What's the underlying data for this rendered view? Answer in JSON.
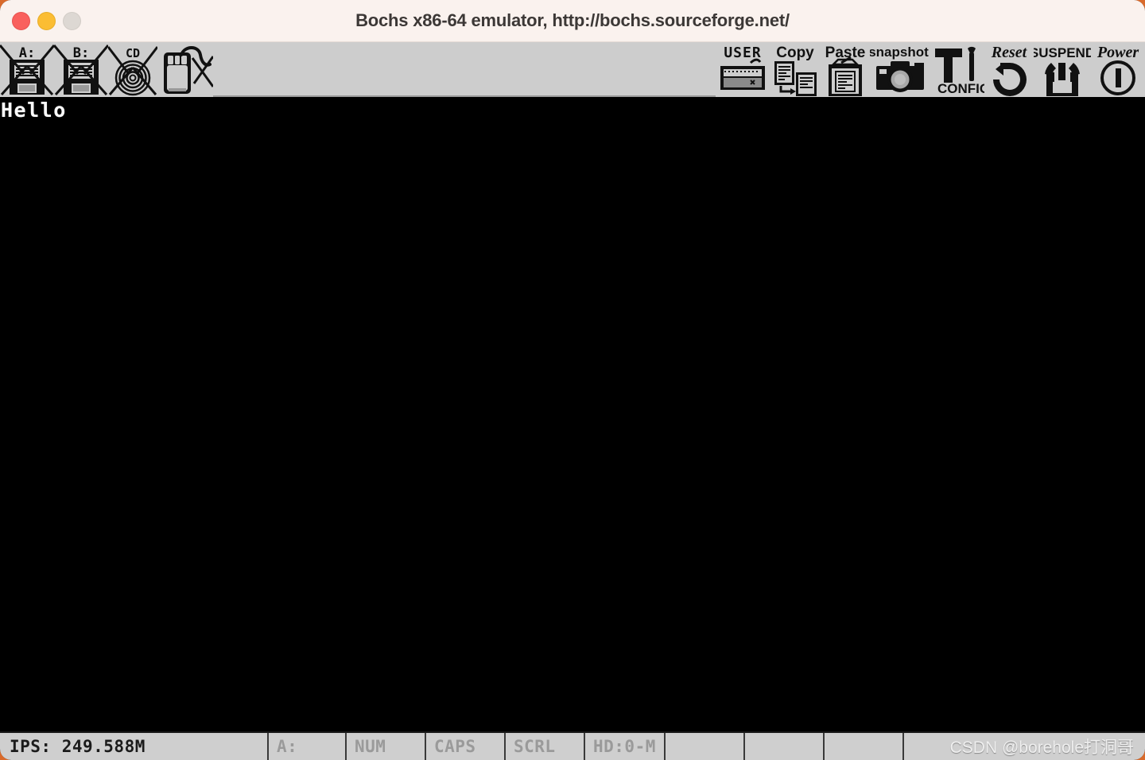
{
  "window": {
    "title": "Bochs x86-64 emulator, http://bochs.sourceforge.net/",
    "controls": {
      "close_label": "",
      "minimize_label": "",
      "maximize_label": ""
    },
    "accent_orange": "#d96a2b",
    "titlebar_bg": "#faf2ee",
    "toolbar_bg": "#cdcdcd",
    "statusbar_bg": "#cfcfcf",
    "screen_bg": "#000000"
  },
  "toolbar": {
    "left_items": [
      {
        "name": "floppy-a",
        "label": "A:",
        "icon": "floppy-icon",
        "disabled": true
      },
      {
        "name": "floppy-b",
        "label": "B:",
        "icon": "floppy-icon",
        "disabled": true
      },
      {
        "name": "cdrom",
        "label": "CD",
        "icon": "cdrom-icon",
        "disabled": true
      },
      {
        "name": "mouse",
        "label": "",
        "icon": "mouse-icon",
        "disabled": true
      }
    ],
    "right_items": [
      {
        "name": "user",
        "label": "USER",
        "icon": "keyboard-icon"
      },
      {
        "name": "copy",
        "label": "Copy",
        "icon": "copy-icon"
      },
      {
        "name": "paste",
        "label": "Paste",
        "icon": "clipboard-icon"
      },
      {
        "name": "snapshot",
        "label": "snapshot",
        "icon": "camera-icon"
      },
      {
        "name": "config",
        "label": "CONFIG",
        "icon": "tools-icon"
      },
      {
        "name": "reset",
        "label": "Reset",
        "icon": "reset-arrow-icon"
      },
      {
        "name": "suspend",
        "label": "SUSPEND",
        "icon": "suspend-icon"
      },
      {
        "name": "power",
        "label": "Power",
        "icon": "power-icon"
      }
    ]
  },
  "screen": {
    "console_text": "Hello"
  },
  "statusbar": {
    "ips": "IPS:  249.588M",
    "cells": [
      {
        "name": "drive-indicator",
        "label": "A:",
        "active": false
      },
      {
        "name": "num-lock-indicator",
        "label": "NUM",
        "active": false
      },
      {
        "name": "caps-lock-indicator",
        "label": "CAPS",
        "active": false
      },
      {
        "name": "scroll-lock-indicator",
        "label": "SCRL",
        "active": false
      },
      {
        "name": "hd-indicator",
        "label": "HD:0-M",
        "active": false
      },
      {
        "name": "blank-cell-1",
        "label": "",
        "active": false
      },
      {
        "name": "blank-cell-2",
        "label": "",
        "active": false
      },
      {
        "name": "blank-cell-3",
        "label": "",
        "active": false
      },
      {
        "name": "blank-cell-4",
        "label": "",
        "active": false
      }
    ],
    "watermark": "CSDN @borehole打洞哥"
  }
}
